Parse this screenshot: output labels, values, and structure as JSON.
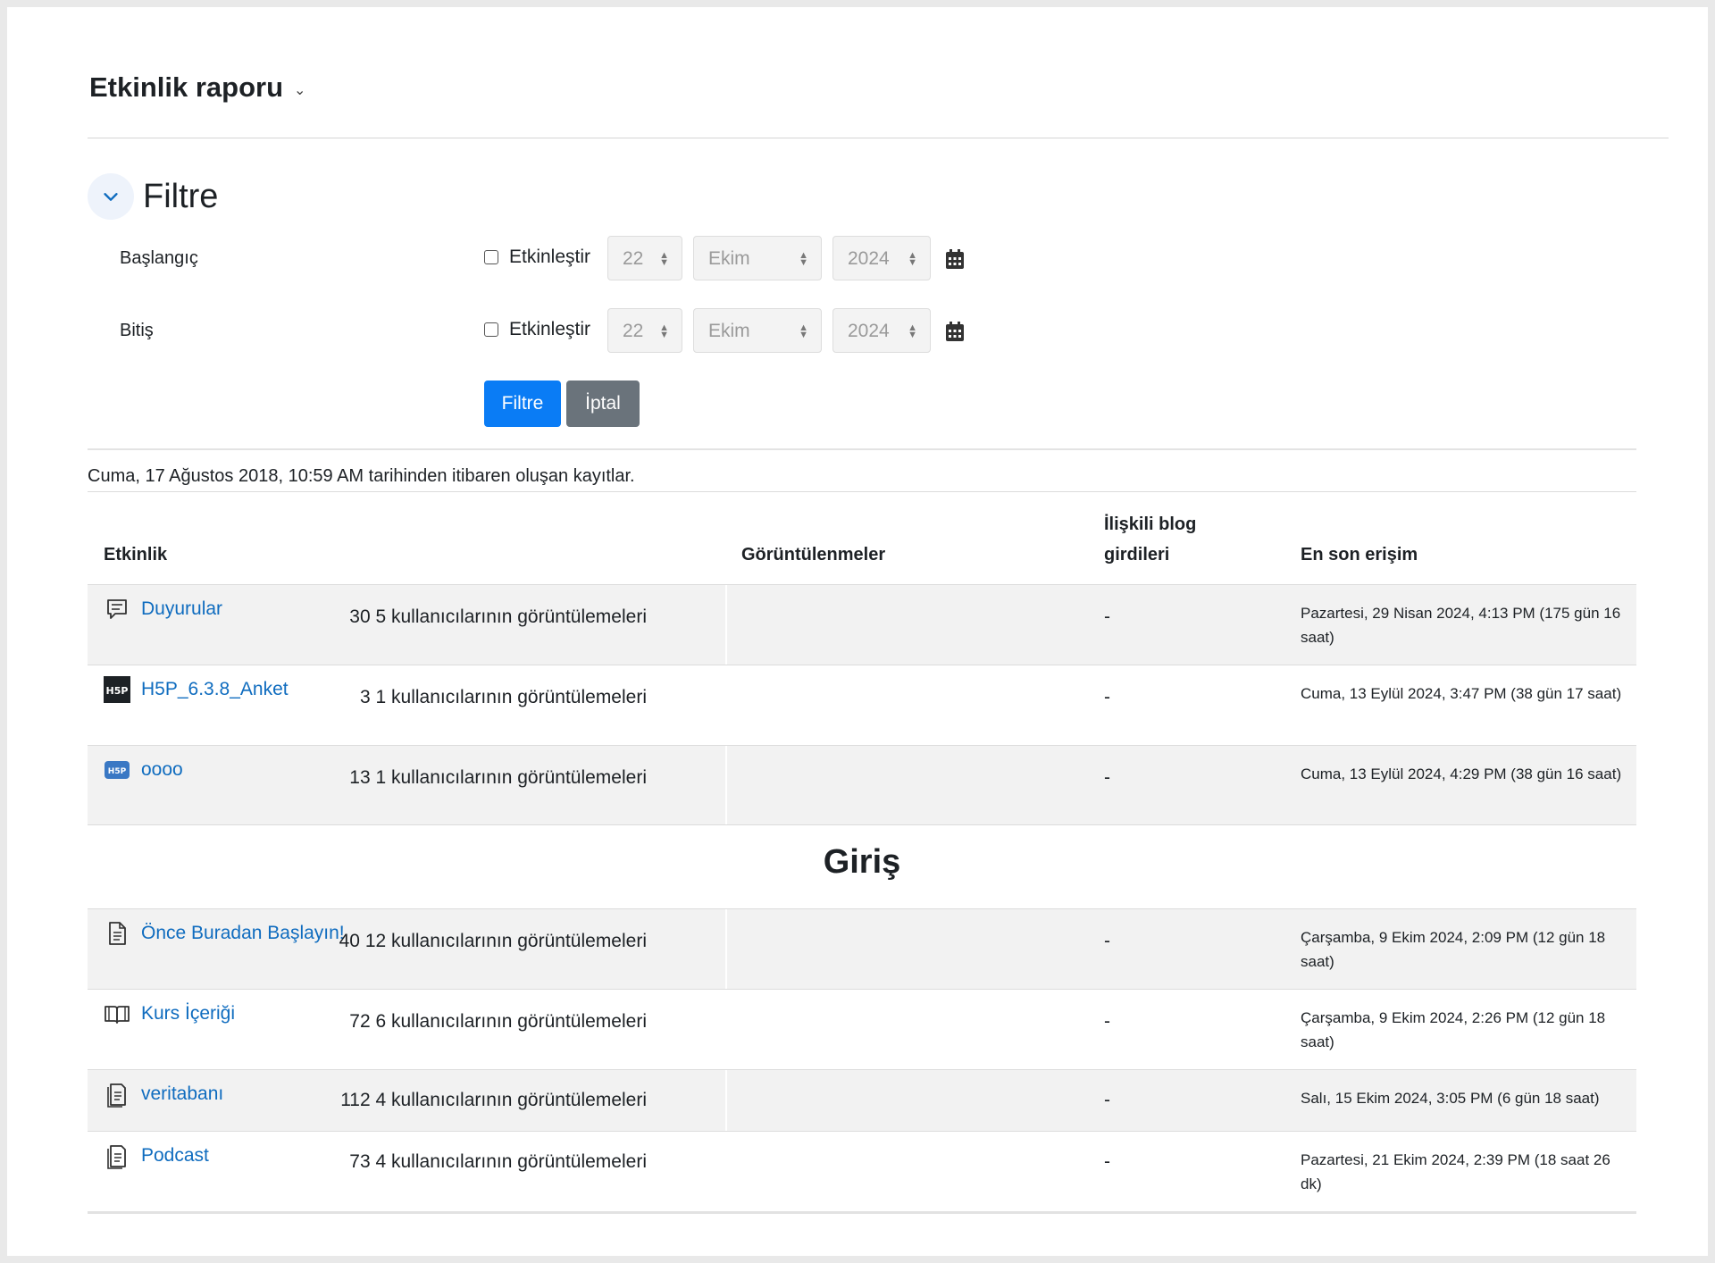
{
  "header": {
    "title": "Etkinlik raporu"
  },
  "filter": {
    "title": "Filtre",
    "start": {
      "label": "Başlangıç",
      "enable_label": "Etkinleştir",
      "day": "22",
      "month": "Ekim",
      "year": "2024"
    },
    "end": {
      "label": "Bitiş",
      "enable_label": "Etkinleştir",
      "day": "22",
      "month": "Ekim",
      "year": "2024"
    },
    "filter_button": "Filtre",
    "cancel_button": "İptal"
  },
  "since_text": "Cuma, 17 Ağustos 2018, 10:59 AM tarihinden itibaren oluşan kayıtlar.",
  "table": {
    "headers": {
      "activity": "Etkinlik",
      "views": "Görüntülenmeler",
      "blog_line1": "İlişkili blog",
      "blog_line2": "girdileri",
      "last_access": "En son erişim"
    },
    "rows": [
      {
        "icon": "forum-icon",
        "name": "Duyurular",
        "views": "30 5 kullanıcılarının görüntülemeleri",
        "blog": "-",
        "last": "Pazartesi, 29 Nisan 2024, 4:13 PM (175 gün 16 saat)"
      },
      {
        "icon": "h5p-icon",
        "name": "H5P_6.3.8_Anket",
        "views": "3 1 kullanıcılarının görüntülemeleri",
        "blog": "-",
        "last": "Cuma, 13 Eylül 2024, 3:47 PM (38 gün 17 saat)"
      },
      {
        "icon": "h5p-activity-icon",
        "name": "oooo",
        "views": "13 1 kullanıcılarının görüntülemeleri",
        "blog": "-",
        "last": "Cuma, 13 Eylül 2024, 4:29 PM (38 gün 16 saat)"
      }
    ],
    "section_title": "Giriş",
    "section_rows": [
      {
        "icon": "page-icon",
        "name": "Önce Buradan Başlayın!",
        "views": "40 12 kullanıcılarının görüntülemeleri",
        "blog": "-",
        "last": "Çarşamba, 9 Ekim 2024, 2:09 PM (12 gün 18 saat)"
      },
      {
        "icon": "book-icon",
        "name": "Kurs İçeriği",
        "views": "72 6 kullanıcılarının görüntülemeleri",
        "blog": "-",
        "last": "Çarşamba, 9 Ekim 2024, 2:26 PM (12 gün 18 saat)"
      },
      {
        "icon": "resource-icon",
        "name": "veritabanı",
        "views": "112 4 kullanıcılarının görüntülemeleri",
        "blog": "-",
        "last": "Salı, 15 Ekim 2024, 3:05 PM (6 gün 18 saat)"
      },
      {
        "icon": "resource-icon",
        "name": "Podcast",
        "views": "73 4 kullanıcılarının görüntülemeleri",
        "blog": "-",
        "last": "Pazartesi, 21 Ekim 2024, 2:39 PM (18 saat 26 dk)"
      }
    ]
  }
}
